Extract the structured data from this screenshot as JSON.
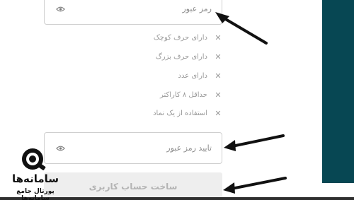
{
  "password": {
    "placeholder": "رمز عبور",
    "toggle_icon": "eye-icon"
  },
  "rules": [
    {
      "text": "دارای حرف کوچک",
      "status_icon": "close-icon"
    },
    {
      "text": "دارای حرف بزرگ",
      "status_icon": "close-icon"
    },
    {
      "text": "دارای عدد",
      "status_icon": "close-icon"
    },
    {
      "text": "حداقل ۸ کاراکتر",
      "status_icon": "close-icon"
    },
    {
      "text": "استفاده از یک نماد",
      "status_icon": "close-icon"
    }
  ],
  "confirm_password": {
    "placeholder": "تایید رمز عبور",
    "toggle_icon": "eye-icon"
  },
  "submit": {
    "label": "ساخت حساب کاربری"
  },
  "watermark": {
    "name": "سامانه‌ها",
    "tagline": "پورتال جامع سامانه‌ها"
  },
  "colors": {
    "side_panel": "#074753",
    "annotation_arrows": "#111111",
    "rule_text": "#9a9a9a",
    "button_bg": "#eeeeee"
  }
}
